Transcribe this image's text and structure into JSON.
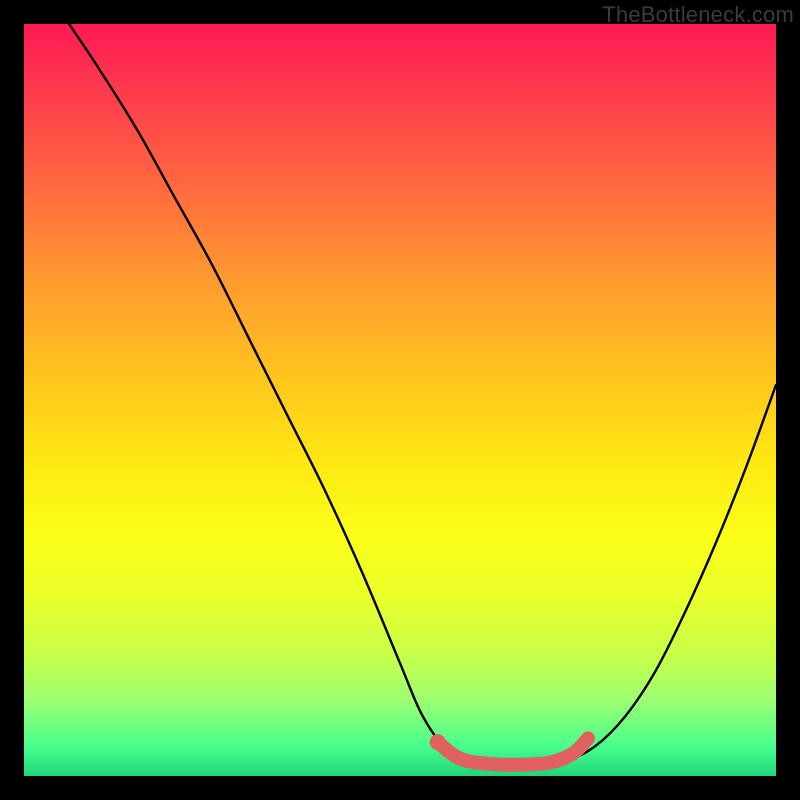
{
  "watermark": "TheBottleneck.com",
  "colors": {
    "curve": "#000000",
    "highlight": "#e16060",
    "background_top": "#ff1a55",
    "background_bottom": "#1fd67a",
    "frame": "#000000"
  },
  "chart_data": {
    "type": "line",
    "title": "",
    "xlabel": "",
    "ylabel": "",
    "xlim": [
      0,
      100
    ],
    "ylim": [
      0,
      100
    ],
    "series": [
      {
        "name": "bottleneck-curve",
        "x": [
          6,
          10,
          15,
          20,
          25,
          30,
          35,
          40,
          45,
          50,
          53,
          56,
          60,
          64,
          68,
          72,
          76,
          80,
          84,
          88,
          92,
          96,
          100
        ],
        "y": [
          100,
          94,
          86,
          77,
          68,
          58,
          48,
          38,
          27,
          15,
          8,
          4,
          2,
          1.5,
          1.5,
          2,
          4,
          8,
          14,
          22,
          31,
          41,
          52
        ]
      },
      {
        "name": "optimal-zone",
        "x": [
          55,
          58,
          62,
          66,
          70,
          73,
          75
        ],
        "y": [
          4.5,
          2.3,
          1.6,
          1.5,
          1.8,
          3.0,
          5.0
        ]
      }
    ],
    "annotations": []
  }
}
